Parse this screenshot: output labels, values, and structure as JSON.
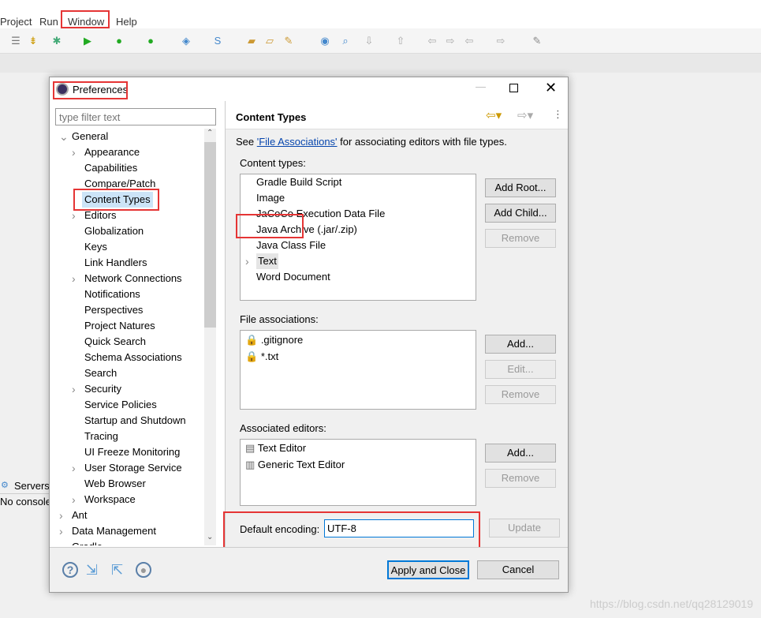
{
  "menubar": {
    "items": [
      "Project",
      "Run",
      "Window",
      "Help"
    ]
  },
  "side": {
    "servers": "Servers",
    "console": "No console"
  },
  "dialog": {
    "title": "Preferences",
    "filter_placeholder": "type filter text",
    "tree": [
      {
        "label": "General",
        "level": 0,
        "expanded": true
      },
      {
        "label": "Appearance",
        "level": 1,
        "arrow": true
      },
      {
        "label": "Capabilities",
        "level": 1
      },
      {
        "label": "Compare/Patch",
        "level": 1
      },
      {
        "label": "Content Types",
        "level": 1,
        "selected": true
      },
      {
        "label": "Editors",
        "level": 1,
        "arrow": true
      },
      {
        "label": "Globalization",
        "level": 1
      },
      {
        "label": "Keys",
        "level": 1
      },
      {
        "label": "Link Handlers",
        "level": 1
      },
      {
        "label": "Network Connections",
        "level": 1,
        "arrow": true
      },
      {
        "label": "Notifications",
        "level": 1
      },
      {
        "label": "Perspectives",
        "level": 1
      },
      {
        "label": "Project Natures",
        "level": 1
      },
      {
        "label": "Quick Search",
        "level": 1
      },
      {
        "label": "Schema Associations",
        "level": 1
      },
      {
        "label": "Search",
        "level": 1
      },
      {
        "label": "Security",
        "level": 1,
        "arrow": true
      },
      {
        "label": "Service Policies",
        "level": 1
      },
      {
        "label": "Startup and Shutdown",
        "level": 1
      },
      {
        "label": "Tracing",
        "level": 1
      },
      {
        "label": "UI Freeze Monitoring",
        "level": 1
      },
      {
        "label": "User Storage Service",
        "level": 1,
        "arrow": true
      },
      {
        "label": "Web Browser",
        "level": 1
      },
      {
        "label": "Workspace",
        "level": 1,
        "arrow": true
      },
      {
        "label": "Ant",
        "level": 0,
        "arrow": true
      },
      {
        "label": "Data Management",
        "level": 0,
        "arrow": true
      },
      {
        "label": "Gradle",
        "level": 0,
        "arrow": true
      }
    ],
    "page_title": "Content Types",
    "see_prefix": "See ",
    "see_link": "'File Associations'",
    "see_suffix": " for associating editors with file types.",
    "content_types_label": "Content types:",
    "content_types": [
      "Gradle Build Script",
      "Image",
      "JaCoCo Execution Data File",
      "Java Archive (.jar/.zip)",
      "Java Class File",
      "Text",
      "Word Document"
    ],
    "add_root": "Add Root...",
    "add_child": "Add Child...",
    "remove": "Remove",
    "file_assoc_label": "File associations:",
    "file_assoc": [
      ".gitignore",
      "*.txt"
    ],
    "add": "Add...",
    "edit": "Edit...",
    "editors_label": "Associated editors:",
    "editors": [
      "Text Editor",
      "Generic Text Editor"
    ],
    "encoding_label": "Default encoding:",
    "encoding_value": "UTF-8",
    "update": "Update",
    "apply_close": "Apply and Close",
    "cancel": "Cancel"
  },
  "watermark": "https://blog.csdn.net/qq28129019"
}
